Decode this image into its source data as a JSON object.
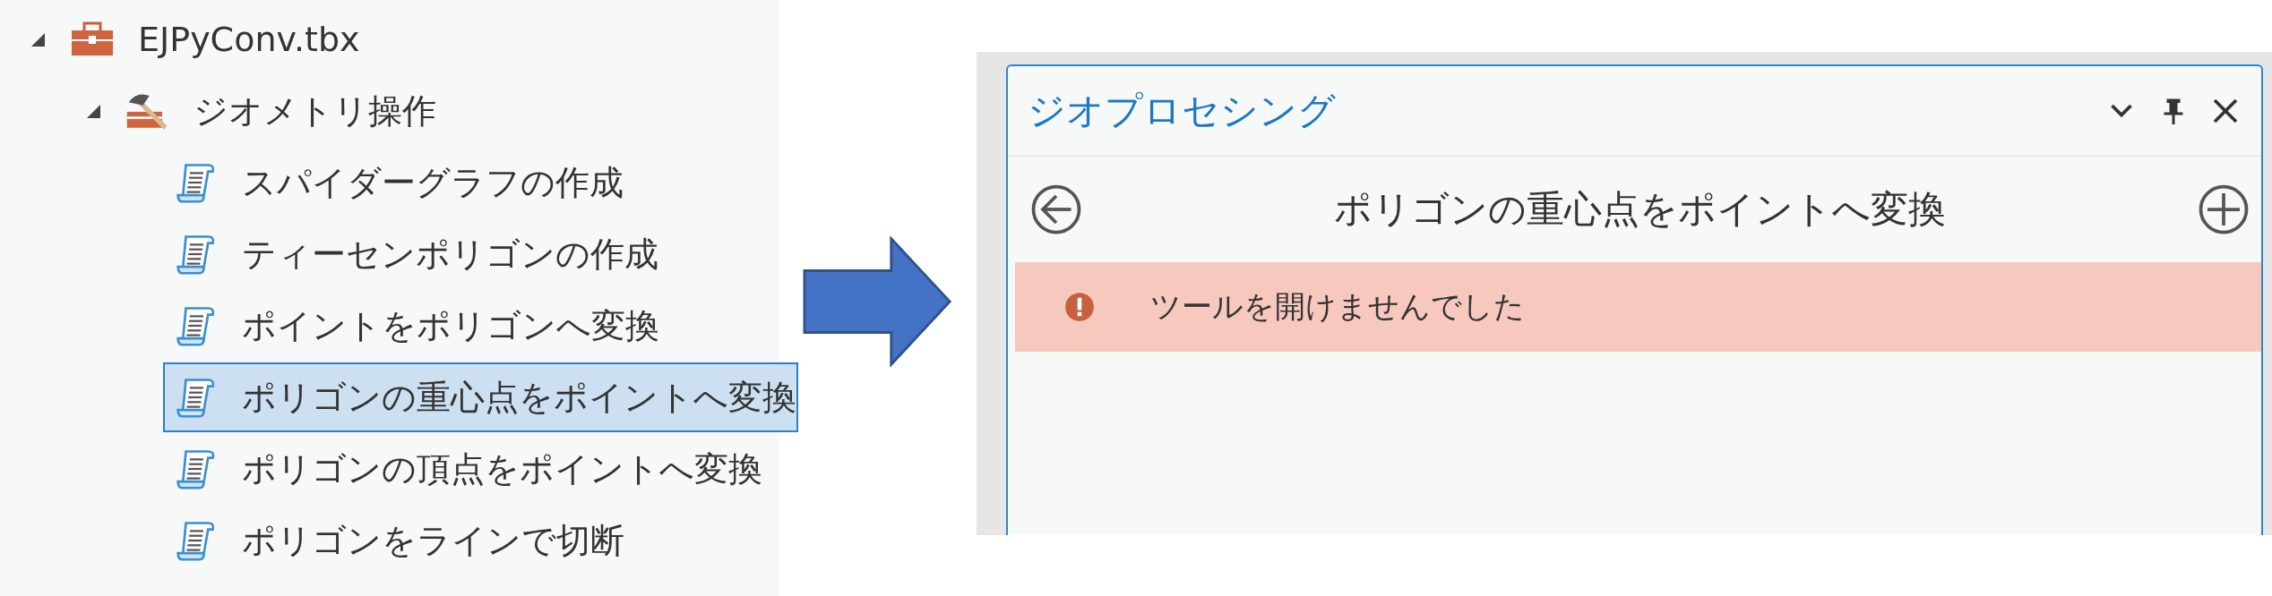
{
  "tree": [
    {
      "kind": "toolbox",
      "label": "EJPyConv.tbx",
      "expanded": true,
      "children": [
        {
          "kind": "toolset",
          "label": "ジオメトリ操作",
          "expanded": true,
          "children": [
            {
              "kind": "tool",
              "label": "スパイダーグラフの作成",
              "selected": false
            },
            {
              "kind": "tool",
              "label": "ティーセンポリゴンの作成",
              "selected": false
            },
            {
              "kind": "tool",
              "label": "ポイントをポリゴンへ変換",
              "selected": false
            },
            {
              "kind": "tool",
              "label": "ポリゴンの重心点をポイントへ変換",
              "selected": true
            },
            {
              "kind": "tool",
              "label": "ポリゴンの頂点をポイントへ変換",
              "selected": false
            },
            {
              "kind": "tool",
              "label": "ポリゴンをラインで切断",
              "selected": false
            }
          ]
        }
      ]
    }
  ],
  "panel": {
    "title": "ジオプロセシング",
    "tool_title": "ポリゴンの重心点をポイントへ変換",
    "error": "ツールを開けませんでした"
  }
}
